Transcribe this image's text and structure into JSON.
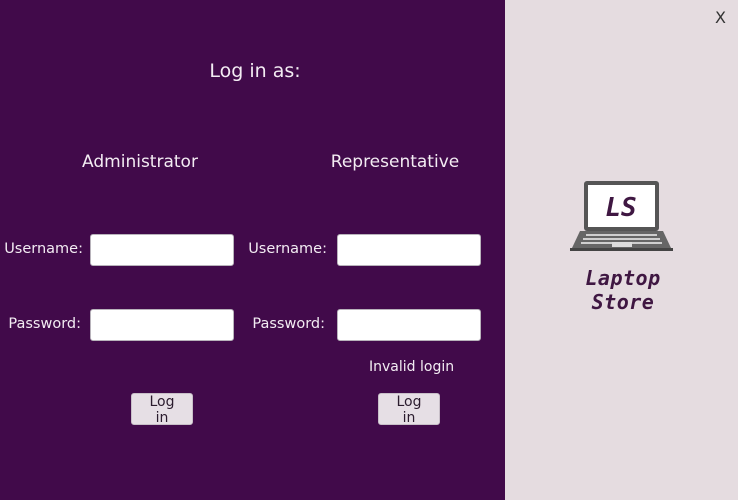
{
  "heading": "Log in as:",
  "admin": {
    "title": "Administrator",
    "username_label": "Username:",
    "password_label": "Password:",
    "username_value": "",
    "password_value": "",
    "login_label": "Log in"
  },
  "rep": {
    "title": "Representative",
    "username_label": "Username:",
    "password_label": "Password:",
    "username_value": "",
    "password_value": "",
    "error": "Invalid login",
    "login_label": "Log in"
  },
  "close_label": "X",
  "logo": {
    "monogram": "LS",
    "brand": "Laptop Store",
    "icon": "laptop-icon"
  },
  "colors": {
    "left_bg": "#410a4a",
    "right_bg": "#e5dce0",
    "brand": "#3f1742"
  }
}
